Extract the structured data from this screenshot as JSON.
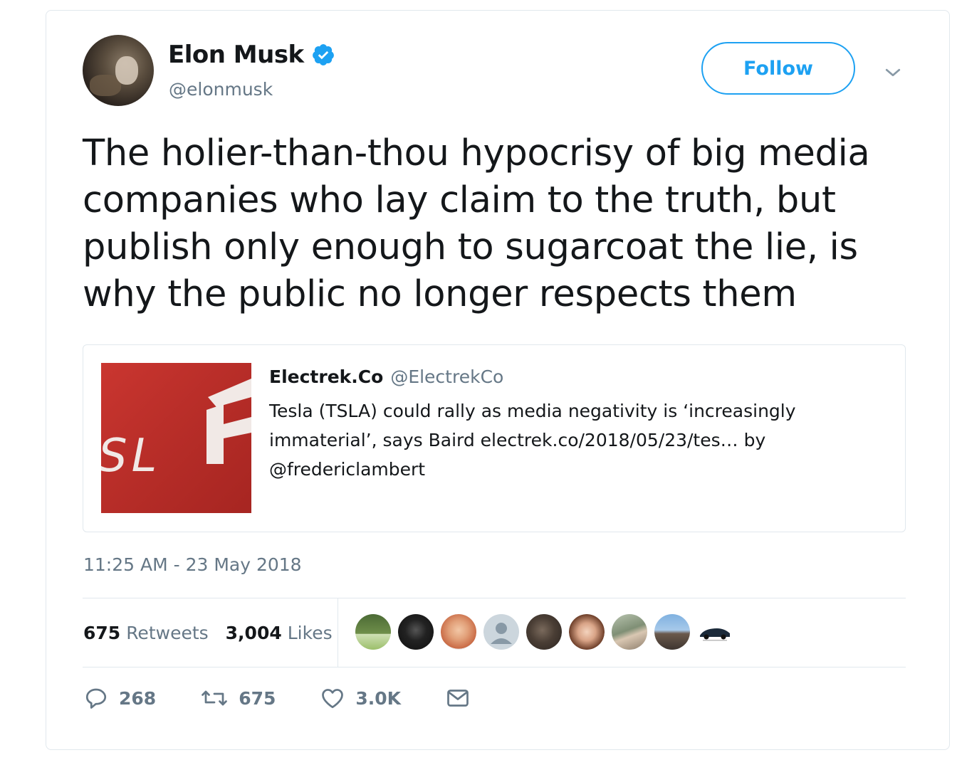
{
  "tweet": {
    "author": {
      "display_name": "Elon Musk",
      "handle": "@elonmusk",
      "verified": true
    },
    "follow_label": "Follow",
    "text": "The holier-than-thou hypocrisy of big media companies who lay claim to the truth, but publish only enough to sugarcoat the lie, is why the public no longer respects them",
    "quoted": {
      "display_name": "Electrek.Co",
      "handle": "@ElectrekCo",
      "text": "Tesla (TSLA) could rally as media negativity is ‘increasingly immaterial’, says Baird electrek.co/2018/05/23/tes… by @fredericlambert",
      "thumbnail_text": "SL"
    },
    "timestamp": "11:25 AM - 23 May 2018",
    "stats": {
      "retweets_count": "675",
      "retweets_label": "Retweets",
      "likes_count": "3,004",
      "likes_label": "Likes"
    },
    "actions": {
      "reply_count": "268",
      "retweet_count": "675",
      "like_count": "3.0K"
    }
  },
  "colors": {
    "accent": "#1da1f2",
    "text_primary": "#14171a",
    "text_secondary": "#657786",
    "border": "#e1e8ed",
    "thumbnail_red": "#c0302b"
  },
  "icons": {
    "verified": "verified-badge-icon",
    "more": "chevron-down-icon",
    "reply": "reply-icon",
    "retweet": "retweet-icon",
    "like": "heart-icon",
    "message": "envelope-icon"
  }
}
